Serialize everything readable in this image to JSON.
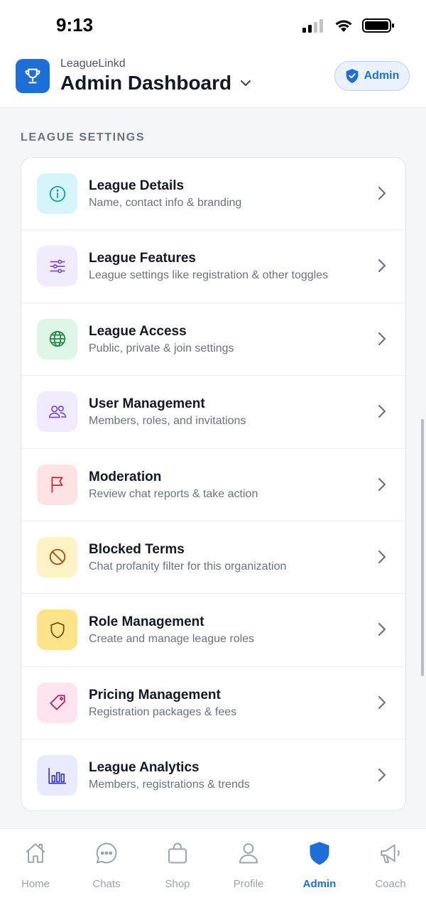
{
  "status_bar": {
    "time": "9:13"
  },
  "header": {
    "app_name": "LeagueLinkd",
    "title": "Admin Dashboard",
    "badge_label": "Admin"
  },
  "section": {
    "title": "LEAGUE SETTINGS"
  },
  "settings": [
    {
      "title": "League Details",
      "subtitle": "Name, contact info & branding",
      "icon": "info-icon",
      "icon_bg": "#d6f5fa",
      "icon_color": "#0e9bb5"
    },
    {
      "title": "League Features",
      "subtitle": "League settings like registration & other toggles",
      "icon": "sliders-icon",
      "icon_bg": "#f1ecfd",
      "icon_color": "#7c4ddb"
    },
    {
      "title": "League Access",
      "subtitle": "Public, private & join settings",
      "icon": "globe-icon",
      "icon_bg": "#ddf6e5",
      "icon_color": "#1a8a44"
    },
    {
      "title": "User Management",
      "subtitle": "Members, roles, and invitations",
      "icon": "users-icon",
      "icon_bg": "#f1ecfd",
      "icon_color": "#7c4ddb"
    },
    {
      "title": "Moderation",
      "subtitle": "Review chat reports & take action",
      "icon": "flag-icon",
      "icon_bg": "#fde3e3",
      "icon_color": "#c62828"
    },
    {
      "title": "Blocked Terms",
      "subtitle": "Chat profanity filter for this organization",
      "icon": "blocked-icon",
      "icon_bg": "#fef2c7",
      "icon_color": "#b45309"
    },
    {
      "title": "Role Management",
      "subtitle": "Create and manage league roles",
      "icon": "shield-icon",
      "icon_bg": "#fde38a",
      "icon_color": "#6b4e0f"
    },
    {
      "title": "Pricing Management",
      "subtitle": "Registration packages & fees",
      "icon": "tag-icon",
      "icon_bg": "#fde4ef",
      "icon_color": "#be1b5c"
    },
    {
      "title": "League Analytics",
      "subtitle": "Members, registrations & trends",
      "icon": "bar-chart-icon",
      "icon_bg": "#e8ebfd",
      "icon_color": "#4338ca"
    }
  ],
  "tabs": [
    {
      "label": "Home",
      "icon": "home-icon",
      "active": false
    },
    {
      "label": "Chats",
      "icon": "chat-icon",
      "active": false
    },
    {
      "label": "Shop",
      "icon": "shopping-bag-icon",
      "active": false
    },
    {
      "label": "Profile",
      "icon": "person-icon",
      "active": false
    },
    {
      "label": "Admin",
      "icon": "shield-icon",
      "active": true
    },
    {
      "label": "Coach",
      "icon": "megaphone-icon",
      "active": false
    }
  ],
  "colors": {
    "accent": "#1d6fd8",
    "muted": "#9ca3af"
  }
}
